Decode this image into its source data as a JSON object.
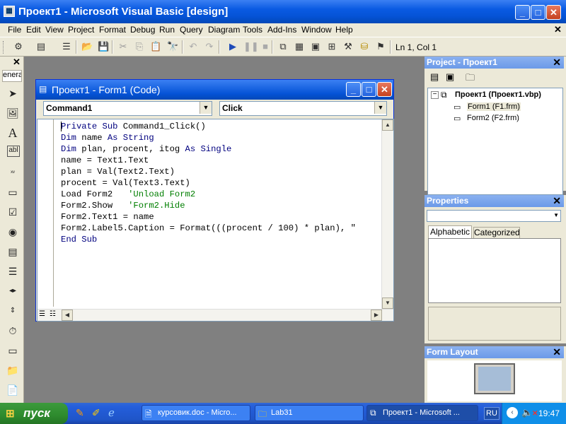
{
  "window": {
    "title": "Проект1 - Microsoft Visual Basic [design]"
  },
  "menu": [
    "File",
    "Edit",
    "View",
    "Project",
    "Format",
    "Debug",
    "Run",
    "Query",
    "Diagram",
    "Tools",
    "Add-Ins",
    "Window",
    "Help"
  ],
  "toolbar": {
    "position": "Ln 1, Col 1"
  },
  "toolbox": {
    "tab_label": "enera"
  },
  "code_window": {
    "title": "Проект1 - Form1 (Code)",
    "object_combo": "Command1",
    "procedure_combo": "Click",
    "lines": [
      [
        {
          "t": "Private Sub ",
          "c": "kw"
        },
        {
          "t": "Command1_Click()",
          "c": ""
        }
      ],
      [
        {
          "t": "Dim ",
          "c": "kw"
        },
        {
          "t": "name ",
          "c": ""
        },
        {
          "t": "As String",
          "c": "kw"
        }
      ],
      [
        {
          "t": "Dim ",
          "c": "kw"
        },
        {
          "t": "plan, procent, itog ",
          "c": ""
        },
        {
          "t": "As Single",
          "c": "kw"
        }
      ],
      [
        {
          "t": "name = Text1.Text",
          "c": ""
        }
      ],
      [
        {
          "t": "plan = Val(Text2.Text)",
          "c": ""
        }
      ],
      [
        {
          "t": "procent = Val(Text3.Text)",
          "c": ""
        }
      ],
      [
        {
          "t": "Load Form2   ",
          "c": ""
        },
        {
          "t": "'Unload Form2",
          "c": "cm"
        }
      ],
      [
        {
          "t": "Form2.Show   ",
          "c": ""
        },
        {
          "t": "'Form2.Hide",
          "c": "cm"
        }
      ],
      [
        {
          "t": "Form2.Text1 = name",
          "c": ""
        }
      ],
      [
        {
          "t": "Form2.Label5.Caption = Format(((procent / 100) * plan), \"",
          "c": ""
        }
      ],
      [
        {
          "t": "End Sub",
          "c": "kw"
        }
      ]
    ]
  },
  "project_panel": {
    "title": "Project - Проект1",
    "root": "Проект1 (Проект1.vbp)",
    "items": [
      "Form1 (F1.frm)",
      "Form2 (F2.frm)"
    ]
  },
  "properties_panel": {
    "title": "Properties",
    "tabs": [
      "Alphabetic",
      "Categorized"
    ]
  },
  "form_layout_panel": {
    "title": "Form Layout"
  },
  "taskbar": {
    "start_label": "пуск",
    "tasks": [
      "курсовик.doc - Micro...",
      "Lab31",
      "Проект1 - Microsoft ..."
    ],
    "language": "RU",
    "clock": "19:47"
  }
}
